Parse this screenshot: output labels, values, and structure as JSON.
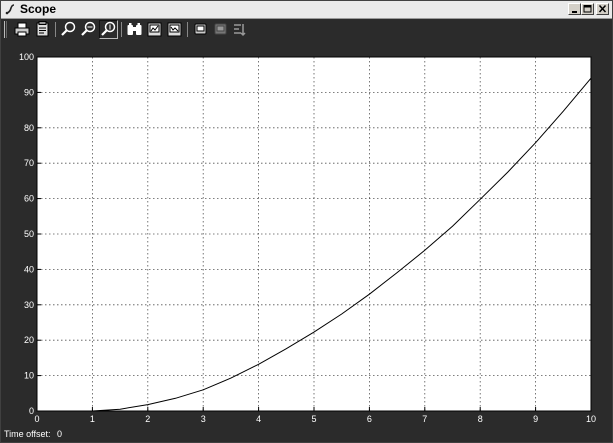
{
  "window": {
    "title": "Scope"
  },
  "toolbar": {
    "buttons": [
      {
        "name": "print-button",
        "icon": "print-icon"
      },
      {
        "name": "parameters-button",
        "icon": "parameters-icon"
      },
      {
        "name": "zoom-button",
        "icon": "zoom-icon"
      },
      {
        "name": "zoom-x-button",
        "icon": "zoom-x-icon"
      },
      {
        "name": "zoom-y-button",
        "icon": "zoom-y-icon"
      },
      {
        "name": "autoscale-button",
        "icon": "binoculars-icon"
      },
      {
        "name": "save-axes-button",
        "icon": "save-axes-icon"
      },
      {
        "name": "restore-axes-button",
        "icon": "restore-axes-icon"
      },
      {
        "name": "floating-scope-button",
        "icon": "floating-scope-icon"
      },
      {
        "name": "lock-axes-button",
        "icon": "lock-axes-icon"
      },
      {
        "name": "signal-selection-button",
        "icon": "signal-selection-icon"
      }
    ]
  },
  "footer": {
    "time_offset_label": "Time offset:",
    "time_offset_value": "0"
  },
  "colors": {
    "chrome": "#2b2b2b",
    "plot_bg": "#ffffff",
    "line": "#000000",
    "tick_text": "#ffffff"
  },
  "chart_data": {
    "type": "line",
    "title": "",
    "xlabel": "",
    "ylabel": "",
    "xlim": [
      0,
      10
    ],
    "ylim": [
      0,
      100
    ],
    "x_ticks": [
      0,
      1,
      2,
      3,
      4,
      5,
      6,
      7,
      8,
      9,
      10
    ],
    "y_ticks": [
      0,
      10,
      20,
      30,
      40,
      50,
      60,
      70,
      80,
      90,
      100
    ],
    "grid": true,
    "series": [
      {
        "x": [
          0,
          1,
          1.5,
          2,
          2.5,
          3,
          3.5,
          4,
          4.5,
          5,
          5.5,
          6,
          6.5,
          7,
          7.5,
          8,
          8.5,
          9,
          9.5,
          10
        ],
        "y": [
          0,
          0,
          0.5,
          1.8,
          3.6,
          6.0,
          9.3,
          13.2,
          17.6,
          22.3,
          27.4,
          33.0,
          39.1,
          45.4,
          52.2,
          59.8,
          67.5,
          75.8,
          84.7,
          94.0
        ]
      }
    ]
  }
}
